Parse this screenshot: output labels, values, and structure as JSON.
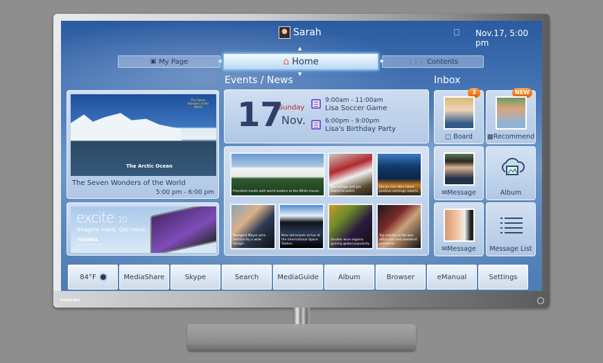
{
  "header": {
    "user_name": "Sarah",
    "network_icon": "network-icon",
    "datetime": "Nov.17, 5:00 pm"
  },
  "nav_tabs": [
    {
      "label": "My Page",
      "icon": "profile-card-icon"
    },
    {
      "label": "Home",
      "icon": "house-icon",
      "active": true
    },
    {
      "label": "Contents",
      "icon": "grid-icon"
    }
  ],
  "sections": {
    "events_title": "Events / News",
    "inbox_title": "Inbox"
  },
  "featured_program": {
    "image_caption": "The Arctic Ocean",
    "image_logo": "The Seven Wonders of the World",
    "title": "The Seven Wonders of the World",
    "time": "5:00 pm - 6:00 pm"
  },
  "ad_banner": {
    "product": "excite",
    "model": "10",
    "tagline": "Imagine more. Get more.",
    "brand": "TOSHIBA",
    "sub": "Leading Innovation >>>"
  },
  "calendar": {
    "day": "17",
    "weekday": "Sunday",
    "month": "Nov.",
    "events": [
      {
        "time": "9:00am - 11:00am",
        "name": "Lisa Soccer Game"
      },
      {
        "time": "6:00pm - 9:00pm",
        "name": "Lisa's Birthday Party"
      }
    ]
  },
  "news": [
    {
      "caption": "President meets with world leaders at the White House"
    },
    {
      "caption": "Top college and pro teams to watch"
    },
    {
      "caption": "Stocks rise after latest positive earnings reports"
    },
    {
      "caption": "Youngest Mayor wins election by a wide margin"
    },
    {
      "caption": "New astronauts arrive at the International Space Station"
    },
    {
      "caption": "Smaller wine regions gaining global popularity"
    },
    {
      "caption": "Top movies at the box office and new weekend premieres"
    }
  ],
  "inbox": [
    {
      "label": "Board",
      "icon": "speech-bubble-icon",
      "badge": "3"
    },
    {
      "label": "Recommend",
      "icon": "video-icon",
      "badge": "NEW"
    },
    {
      "label": "Message",
      "icon": "envelope-icon"
    },
    {
      "label": "Album",
      "icon": "cloud-photo-icon"
    },
    {
      "label": "Message",
      "icon": "envelope-icon"
    },
    {
      "label": "Message List",
      "icon": "list-icon"
    }
  ],
  "bottom_bar": [
    {
      "label": "84°F",
      "icon": "weather-icon"
    },
    {
      "label": "MediaShare"
    },
    {
      "label": "Skype"
    },
    {
      "label": "Search"
    },
    {
      "label": "MediaGuide"
    },
    {
      "label": "Album"
    },
    {
      "label": "Browser"
    },
    {
      "label": "eManual"
    },
    {
      "label": "Settings"
    }
  ],
  "device": {
    "brand": "TOSHIBA"
  }
}
